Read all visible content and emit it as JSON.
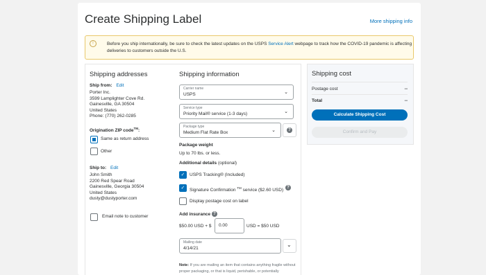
{
  "header": {
    "title": "Create Shipping Label",
    "more_link": "More shipping info"
  },
  "alert": {
    "text_before": "Before you ship internationally, be sure to check the latest updates on the USPS ",
    "link": "Service Alert",
    "text_after": " webpage to track how the COVID-19 pandemic is affecting deliveries to customers outside the U.S."
  },
  "addresses": {
    "heading": "Shipping addresses",
    "ship_from_label": "Ship from:",
    "edit": "Edit",
    "from_lines": [
      "Porter Inc.",
      "3599 Lamplighter Cove Rd.",
      "Gainesville, GA 30504",
      "United States",
      "Phone: (770) 262-0285"
    ],
    "origin_zip_label": "Origination ZIP code",
    "origin_tm": "TM",
    "origin_colon": ":",
    "same_as_return": "Same as return address",
    "other": "Other",
    "ship_to_label": "Ship to:",
    "to_lines": [
      "John Smith",
      "2200 Red Spear Road",
      "Gainesville, Georgia 30504",
      "United States",
      "dusty@dustyporter.com"
    ],
    "email_note": "Email note to customer"
  },
  "shipping_info": {
    "heading": "Shipping information",
    "carrier": {
      "label": "Carrier name",
      "value": "USPS"
    },
    "service": {
      "label": "Service type",
      "value": "Priority Mail® service (1-3 days)"
    },
    "package": {
      "label": "Package type",
      "value": "Medium Flat Rate Box"
    },
    "weight_label": "Package weight",
    "weight_value": "Up to 70 lbs. or less.",
    "additional_label": "Additional details",
    "additional_optional": " (optional)",
    "tracking": "USPS Tracking® (Included)",
    "signature_pre": "Signature Confirmation ",
    "signature_tm": "TM",
    "signature_post": " service ($2.60 USD)",
    "display_postage": "Display postage cost on label",
    "insurance_label": "Add insurance",
    "insurance_prefix": "$50.00 USD + $",
    "insurance_value": "0.00",
    "insurance_total": "USD = $50 USD",
    "mailing": {
      "label": "Mailing date",
      "value": "4/14/21"
    },
    "note_bold": "Note:",
    "note_text": " If you are mailing an item that contains anything fragile without proper packaging, or that is liquid, perishable, or potentially"
  },
  "cost": {
    "heading": "Shipping cost",
    "postage_label": "Postage cost",
    "postage_value": "--",
    "total_label": "Total",
    "total_value": "--",
    "calc_button": "Calculate Shipping Cost",
    "pay_button": "Confirm and Pay"
  },
  "colors": {
    "accent": "#0070ba",
    "alert_border": "#e9c86a",
    "alert_bg": "#fffbea"
  },
  "icons": [
    "info-icon",
    "chevron-down-icon",
    "help-icon",
    "checkbox-icon",
    "calendar-chevron-icon"
  ]
}
